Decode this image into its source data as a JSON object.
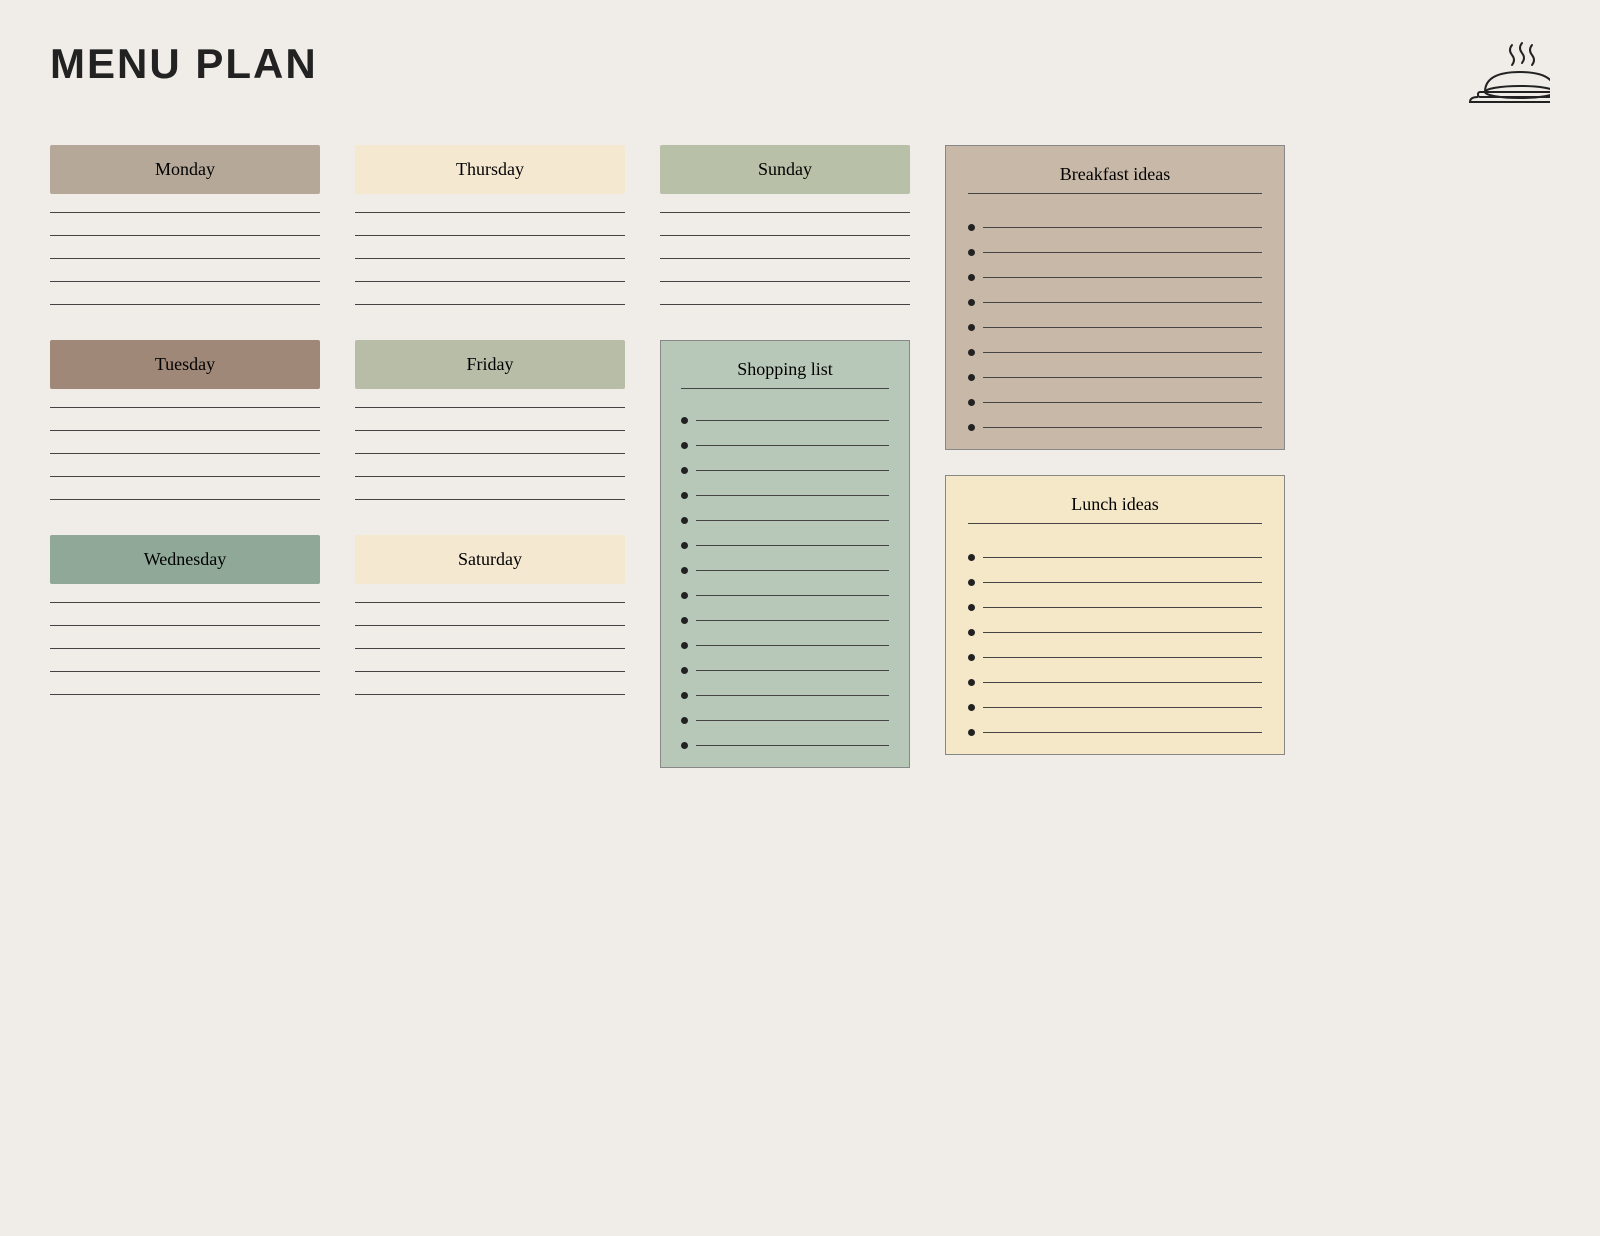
{
  "title": "MENU PLAN",
  "days": {
    "monday": {
      "label": "Monday",
      "color_class": "monday-header",
      "lines": 5
    },
    "tuesday": {
      "label": "Tuesday",
      "color_class": "tuesday-header",
      "lines": 5
    },
    "wednesday": {
      "label": "Wednesday",
      "color_class": "wednesday-header",
      "lines": 5
    },
    "thursday": {
      "label": "Thursday",
      "color_class": "thursday-header",
      "lines": 5
    },
    "friday": {
      "label": "Friday",
      "color_class": "friday-header",
      "lines": 5
    },
    "saturday": {
      "label": "Saturday",
      "color_class": "saturday-header",
      "lines": 5
    },
    "sunday": {
      "label": "Sunday",
      "color_class": "sunday-header",
      "lines": 5
    }
  },
  "shopping_list": {
    "title": "Shopping list",
    "items": 14
  },
  "breakfast_ideas": {
    "title": "Breakfast ideas",
    "items": 9
  },
  "lunch_ideas": {
    "title": "Lunch ideas",
    "items": 8
  }
}
